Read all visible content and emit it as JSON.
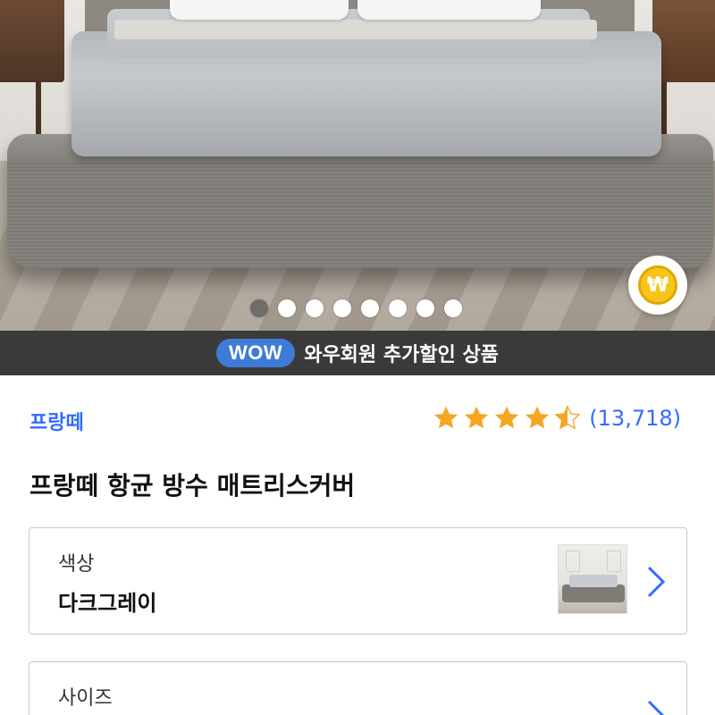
{
  "hero": {
    "carousel": {
      "total": 8,
      "active_index": 0
    },
    "coin_symbol": "₩"
  },
  "wow_banner": {
    "badge": "WOW",
    "text": "와우회원 추가할인 상품"
  },
  "product": {
    "brand": "프랑떼",
    "rating_value": 4.5,
    "rating_count": "(13,718)",
    "title": "프랑떼 항균 방수 매트리스커버"
  },
  "options": [
    {
      "label": "색상",
      "value": "다크그레이"
    },
    {
      "label": "사이즈",
      "value": ""
    }
  ],
  "colors": {
    "link_blue": "#346aff",
    "wow_blue": "#3e7bd6",
    "banner_bg": "#3a3a3a",
    "star": "#f5a623"
  },
  "icons": {
    "star": "star-icon",
    "chevron": "chevron-right-icon",
    "coin": "won-coin-icon"
  }
}
